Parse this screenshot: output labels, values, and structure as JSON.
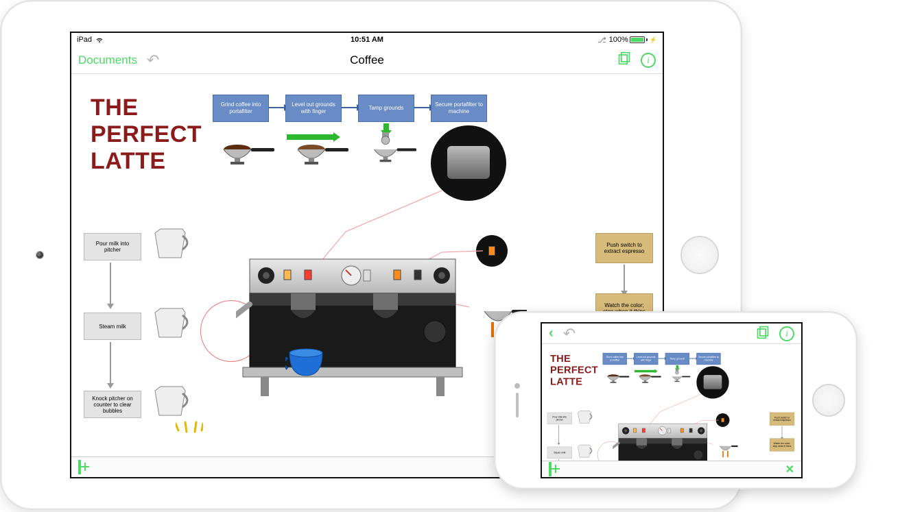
{
  "status": {
    "carrier": "iPad",
    "time": "10:51 AM",
    "battery_pct": "100%"
  },
  "navbar": {
    "back_label": "Documents",
    "title": "Coffee"
  },
  "diagram": {
    "title_line1": "THE",
    "title_line2": "PERFECT",
    "title_line3": "LATTE",
    "top_steps": {
      "grind": "Grind coffee into portafilter",
      "level": "Level out grounds with finger",
      "tamp": "Tamp grounds",
      "secure": "Secure portafilter to machine"
    },
    "left_steps": {
      "pour": "Pour milk into pitcher",
      "steam": "Steam milk",
      "knock": "Knock pitcher on counter to clear bubbles"
    },
    "right_steps": {
      "push": "Push switch to extract espresso",
      "watch": "Watch the color; stop when it thins"
    }
  }
}
